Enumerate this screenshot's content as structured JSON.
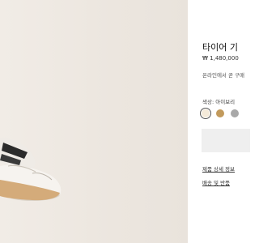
{
  "product": {
    "title": "타이어 기",
    "price": "₩ 1,480,000",
    "online_note": "온라인에서 곧 구매",
    "color_label": "색상: 아이보리",
    "swatches": [
      {
        "name": "ivory",
        "color": "#f4ead9",
        "selected": true
      },
      {
        "name": "tan",
        "color": "#c29a5c",
        "selected": false
      },
      {
        "name": "grey",
        "color": "#a8a8a8",
        "selected": false
      }
    ],
    "add_to_cart_label": ""
  },
  "links": {
    "details": "제품 상세 정보",
    "shipping": "배송 및 반품"
  },
  "colors": {
    "background": "#ffffff",
    "photo_bg": "#ece6df",
    "button_bg": "#efefef"
  }
}
